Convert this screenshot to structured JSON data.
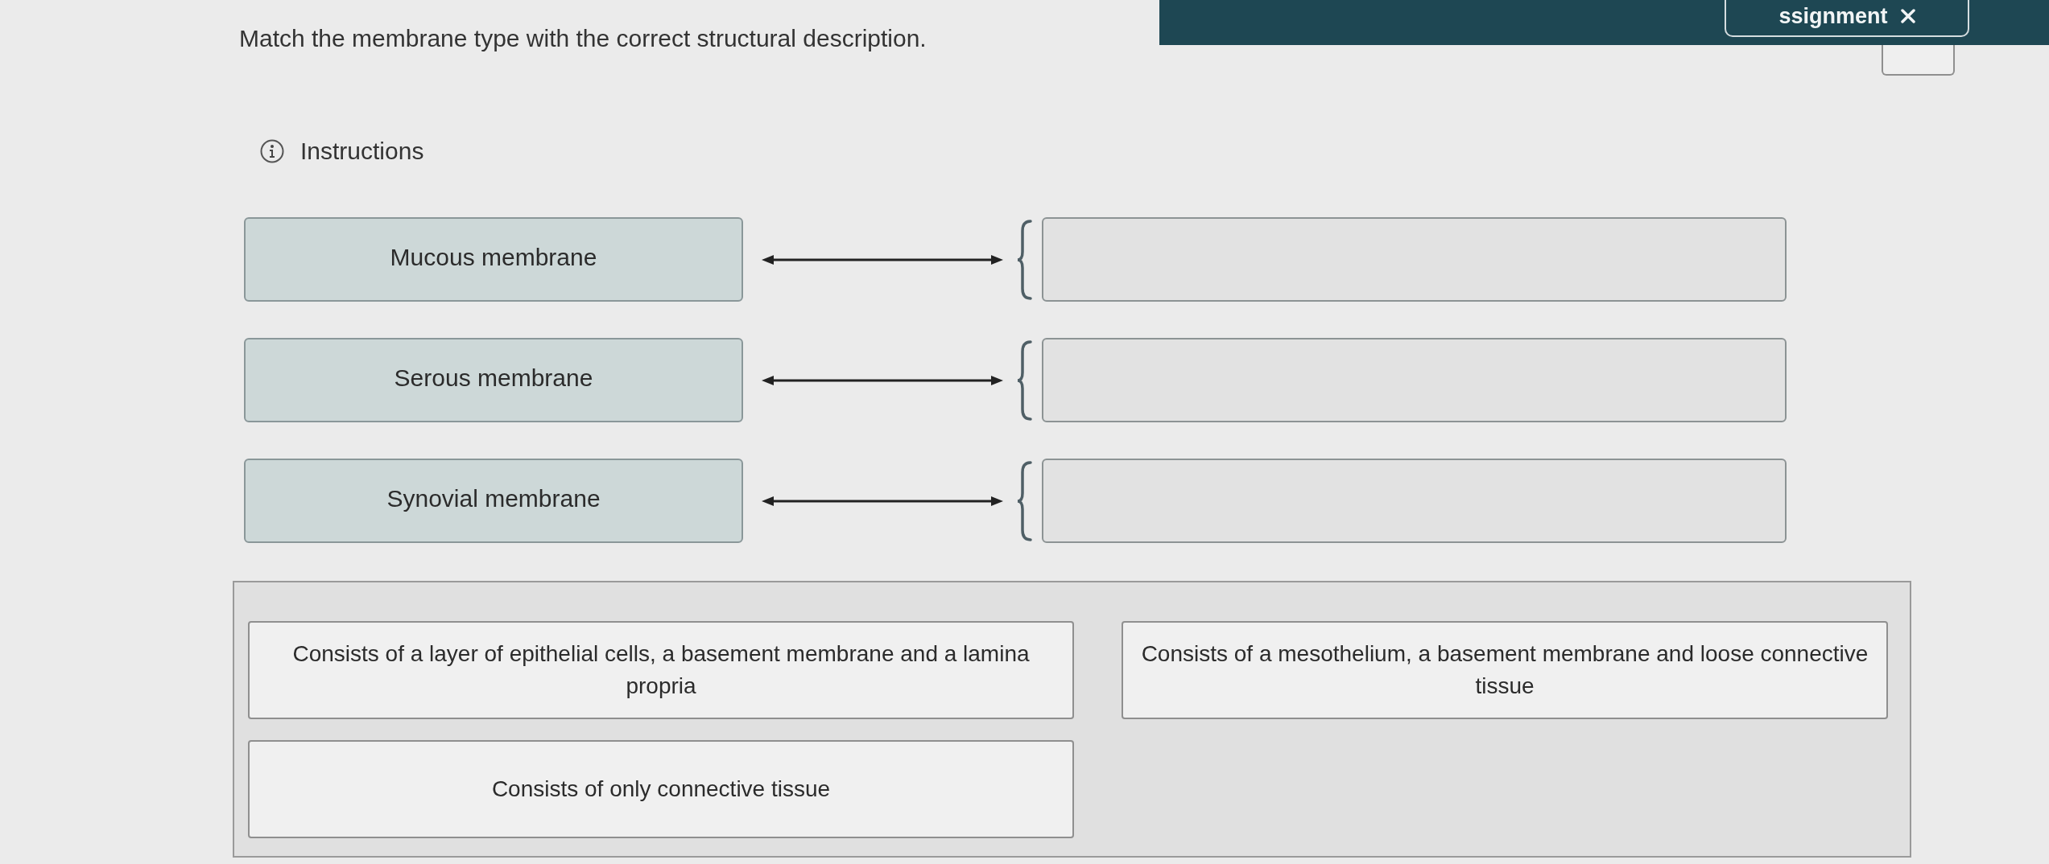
{
  "top_bar": {
    "button_label": "ssignment"
  },
  "question": {
    "prompt": "Match the membrane type with the correct structural description.",
    "instructions": "Instructions"
  },
  "pairs": [
    {
      "term": "Mucous membrane"
    },
    {
      "term": "Serous membrane"
    },
    {
      "term": "Synovial membrane"
    }
  ],
  "answer_bank": [
    "Consists of a layer of epithelial cells, a basement membrane and a lamina propria",
    "Consists of a mesothelium, a basement membrane and loose connective tissue",
    "Consists of only connective tissue"
  ]
}
